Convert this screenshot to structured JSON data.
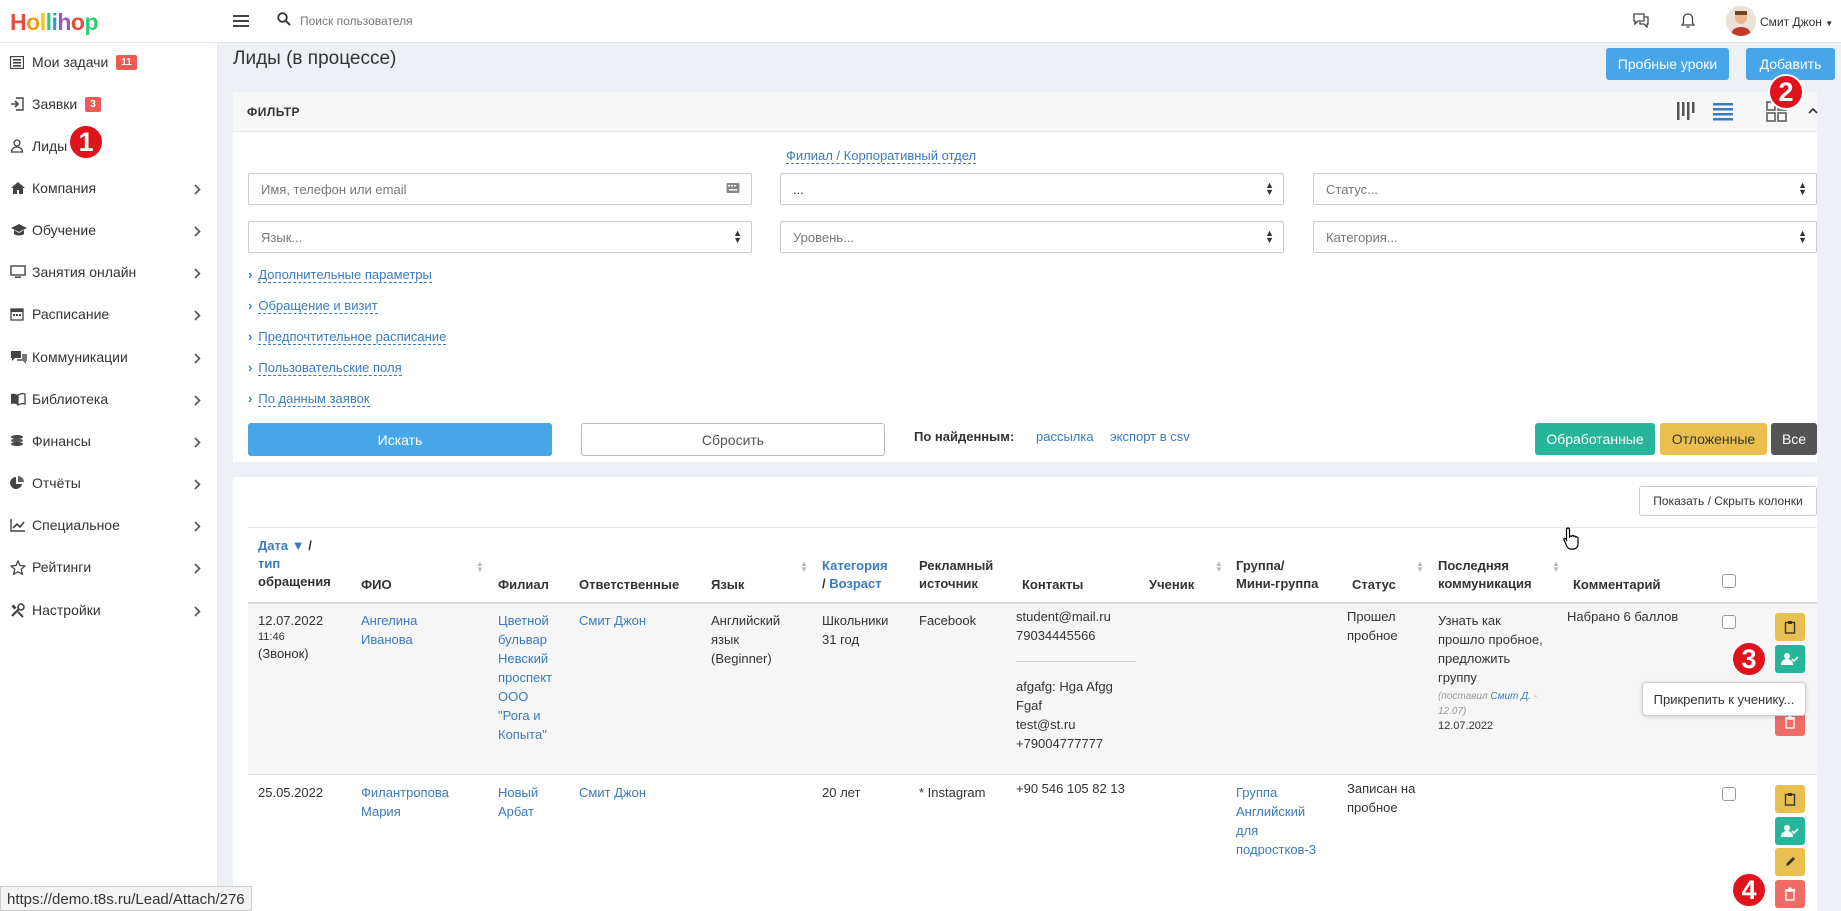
{
  "app": {
    "logo": [
      "H",
      "o",
      "l",
      "l",
      "i",
      "h",
      "o",
      "p"
    ],
    "logo_colors": [
      "#e74c3c",
      "#f39c12",
      "#f1c40f",
      "#2ecc71",
      "#3498db",
      "#9b59b6",
      "#e74c3c",
      "#2ecc71"
    ]
  },
  "topbar": {
    "search_placeholder": "Поиск пользователя",
    "user_name": "Смит Джон"
  },
  "sidebar": {
    "items": [
      {
        "label": "Мои задачи",
        "badge": "11",
        "icon": "list-icon"
      },
      {
        "label": "Заявки",
        "badge": "3",
        "icon": "sign-in-icon"
      },
      {
        "label": "Лиды",
        "icon": "user-icon"
      },
      {
        "label": "Компания",
        "icon": "home-icon"
      },
      {
        "label": "Обучение",
        "icon": "graduation-cap-icon"
      },
      {
        "label": "Занятия онлайн",
        "icon": "monitor-icon"
      },
      {
        "label": "Расписание",
        "icon": "calendar-icon"
      },
      {
        "label": "Коммуникации",
        "icon": "comments-icon"
      },
      {
        "label": "Библиотека",
        "icon": "book-icon"
      },
      {
        "label": "Финансы",
        "icon": "coins-icon"
      },
      {
        "label": "Отчёты",
        "icon": "pie-chart-icon"
      },
      {
        "label": "Специальное",
        "icon": "line-chart-icon"
      },
      {
        "label": "Рейтинги",
        "icon": "star-icon"
      },
      {
        "label": "Настройки",
        "icon": "tools-icon"
      }
    ]
  },
  "page": {
    "title": "Лиды (в процессе)",
    "btn_trial": "Пробные уроки",
    "btn_add": "Добавить"
  },
  "filter": {
    "title": "ФИЛЬТР",
    "branch_link": "Филиал / Корпоративный отдел",
    "name_placeholder": "Имя, телефон или email",
    "branch_value": "...",
    "status_placeholder": "Статус...",
    "language_placeholder": "Язык...",
    "level_placeholder": "Уровень...",
    "category_placeholder": "Категория...",
    "sections": [
      "Дополнительные параметры",
      "Обращение и визит",
      "Предпочтительное расписание",
      "Пользовательские поля",
      "По данным заявок"
    ],
    "btn_search": "Искать",
    "btn_reset": "Сбросить",
    "found_label": "По найденным:",
    "link_mailing": "рассылка",
    "link_export": "экспорт в csv",
    "btn_processed": "Обработанные",
    "btn_postponed": "Отложенные",
    "btn_all": "Все"
  },
  "table": {
    "btn_columns": "Показать / Скрыть колонки",
    "headers": {
      "date_1": "Дата ▼",
      "date_2": " /",
      "date_3": "тип",
      "date_4": "обращения",
      "fio": "ФИО",
      "branch": "Филиал",
      "responsible": "Ответственные",
      "language": "Язык",
      "category_1": "Категория",
      "category_2": "/ ",
      "category_3": "Возраст",
      "ad_1": "Рекламный",
      "ad_2": "источник",
      "contacts": "Контакты",
      "student": "Ученик",
      "group_1": "Группа/",
      "group_2": "Мини-группа",
      "status": "Статус",
      "lastcomm_1": "Последняя",
      "lastcomm_2": "коммуникация",
      "comment": "Комментарий"
    },
    "rows": [
      {
        "date": "12.07.2022",
        "time": "11:46",
        "type": "(Звонок)",
        "fio": [
          "Ангелина",
          "Иванова"
        ],
        "branch": [
          "Цветной",
          "бульвар",
          "Невский",
          "проспект",
          "ООО",
          "\"Рога и",
          "Копыта\""
        ],
        "responsible": "Смит Джон",
        "language": [
          "Английский",
          "язык",
          "(Beginner)"
        ],
        "category": [
          "Школьники",
          "31 год"
        ],
        "ad": "Facebook",
        "contacts_1": [
          "student@mail.ru",
          "79034445566"
        ],
        "contacts_2": [
          "afgafg: Hga Afgg",
          "Fgaf",
          "test@st.ru",
          "+79004777777"
        ],
        "status": [
          "Прошел",
          "пробное"
        ],
        "lastcomm": [
          "Узнать как",
          "прошло пробное,",
          "предложить",
          "группу"
        ],
        "lastcomm_by_prefix": "(поставил ",
        "lastcomm_by_name": "Смит Д.",
        "lastcomm_by_suffix": " -",
        "lastcomm_by_date": "12.07)",
        "lastcomm_date": "12.07.2022",
        "comment": "Набрано 6 баллов"
      },
      {
        "date": "25.05.2022",
        "fio": [
          "Филантропова",
          "Мария"
        ],
        "branch": [
          "Новый",
          "Арбат"
        ],
        "responsible": "Смит Джон",
        "category": [
          "20 лет"
        ],
        "ad": "* Instagram",
        "contacts_1": [
          "+90 546 105 82 13"
        ],
        "group": [
          "Группа",
          "Английский",
          "для",
          "подростков-3"
        ],
        "status": [
          "Записан на",
          "пробное"
        ]
      }
    ],
    "tooltip": "Прикрепить к ученику..."
  },
  "markers": [
    "1",
    "2",
    "3",
    "4"
  ],
  "status_url": "https://demo.t8s.ru/Lead/Attach/276"
}
